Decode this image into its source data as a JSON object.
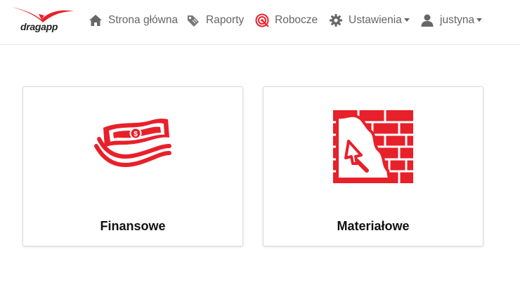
{
  "brand": {
    "name": "dragapp",
    "accent_color": "#e8202a"
  },
  "nav": {
    "items": [
      {
        "label": "Strona główna",
        "icon": "home-icon"
      },
      {
        "label": "Raporty",
        "icon": "tag-icon"
      },
      {
        "label": "Robocze",
        "icon": "target-icon"
      },
      {
        "label": "Ustawienia",
        "icon": "gear-icon",
        "dropdown": true
      },
      {
        "label": "justyna",
        "icon": "user-icon",
        "dropdown": true
      }
    ]
  },
  "cards": [
    {
      "label": "Finansowe",
      "icon": "money-icon"
    },
    {
      "label": "Materiałowe",
      "icon": "brick-wall-trowel-icon"
    }
  ]
}
